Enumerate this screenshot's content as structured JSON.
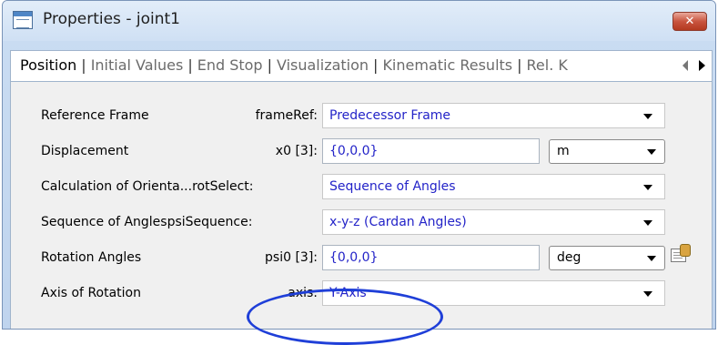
{
  "window": {
    "title": "Properties - joint1",
    "close_symbol": "✕"
  },
  "tabs": [
    {
      "label": "Position",
      "active": true
    },
    {
      "label": "Initial Values",
      "active": false
    },
    {
      "label": "End Stop",
      "active": false
    },
    {
      "label": "Visualization",
      "active": false
    },
    {
      "label": "Kinematic Results",
      "active": false
    },
    {
      "label": "Rel. K",
      "active": false
    }
  ],
  "tab_separator": "|",
  "rows": [
    {
      "label": "Reference Frame",
      "prop": "frameRef:",
      "value": "Predecessor Frame"
    },
    {
      "label": "Displacement",
      "prop": "x0 [3]:",
      "value": "{0,0,0}",
      "unit": "m"
    },
    {
      "label": "Calculation of Orienta...rotSelect:",
      "prop": "",
      "value": "Sequence of Angles"
    },
    {
      "label": "Sequence of AnglespsiSequence:",
      "prop": "",
      "value": "x-y-z (Cardan Angles)"
    },
    {
      "label": "Rotation Angles",
      "prop": "psi0 [3]:",
      "value": "{0,0,0}",
      "unit": "deg"
    },
    {
      "label": "Axis of Rotation",
      "prop": "axis:",
      "value": "Y-Axis"
    }
  ],
  "icons": {
    "window": "properties-window-icon",
    "close": "close-icon",
    "tab_scroll_left": "arrow-left-icon",
    "tab_scroll_right": "arrow-right-icon",
    "dropdown": "chevron-down-icon",
    "edit": "edit-parameter-icon"
  },
  "colors": {
    "value_text": "#2323c8",
    "annotation_ellipse": "#1f3fd8",
    "close_button": "#c9553f"
  }
}
